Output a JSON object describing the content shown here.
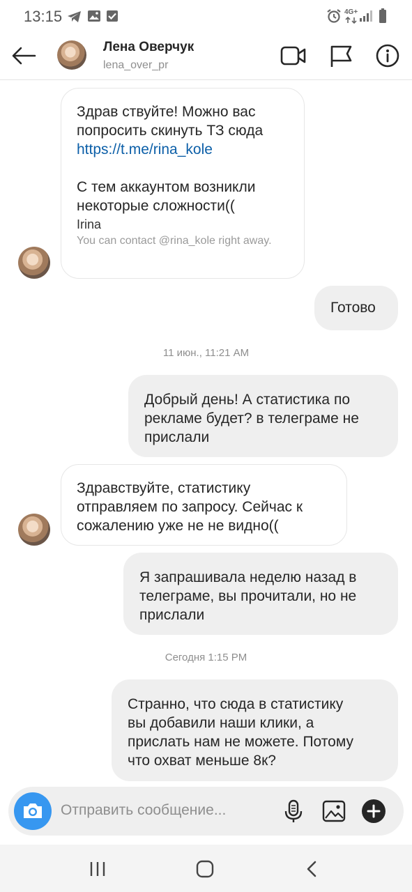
{
  "status_bar": {
    "time": "13:15",
    "network": "4G+",
    "left_icons": [
      "telegram-icon",
      "image-icon",
      "check-square-icon"
    ],
    "right_icons": [
      "alarm-icon",
      "network-icon",
      "signal-icon",
      "battery-icon"
    ]
  },
  "header": {
    "name": "Лена Оверчук",
    "username": "lena_over_pr",
    "icons": [
      "back-arrow-icon",
      "video-call-icon",
      "flag-icon",
      "info-icon"
    ]
  },
  "messages": [
    {
      "direction": "incoming",
      "line1": "Здрав ствуйте! Можно вас",
      "line2": "попросить скинуть ТЗ сюда",
      "link": "https://t.me/rina_kole",
      "line3": "С тем аккаунтом возникли",
      "line4": "некоторые сложности((",
      "signature": "Irina",
      "signature_note": "You can contact @rina_kole right away."
    },
    {
      "direction": "outgoing",
      "text": "Готово"
    },
    {
      "type": "timestamp",
      "text": "11 июн., 11:21 AM"
    },
    {
      "direction": "outgoing",
      "lines": [
        "Добрый день! А статистика по",
        "рекламе будет? в телеграме не",
        "прислали"
      ]
    },
    {
      "direction": "incoming",
      "lines": [
        "Здравствуйте, статистику",
        "отправляем по запросу. Сейчас к",
        "сожалению уже не не видно(("
      ]
    },
    {
      "direction": "outgoing",
      "lines": [
        "Я запрашивала неделю назад в",
        "телеграме, вы прочитали, но не",
        "прислали"
      ]
    },
    {
      "type": "timestamp",
      "text": "Сегодня 1:15 PM"
    },
    {
      "direction": "outgoing",
      "lines": [
        "Странно, что сюда в статистику",
        "вы добавили наши клики, а",
        "прислать нам не можете. Потому",
        "что охват меньше 8к?"
      ]
    }
  ],
  "composer": {
    "placeholder": "Отправить сообщение...",
    "icons": [
      "camera-icon",
      "microphone-icon",
      "gallery-icon",
      "plus-icon"
    ],
    "camera_color": "#3797f0"
  },
  "nav_bar": {
    "icons": [
      "recents-icon",
      "home-icon",
      "back-icon"
    ]
  }
}
